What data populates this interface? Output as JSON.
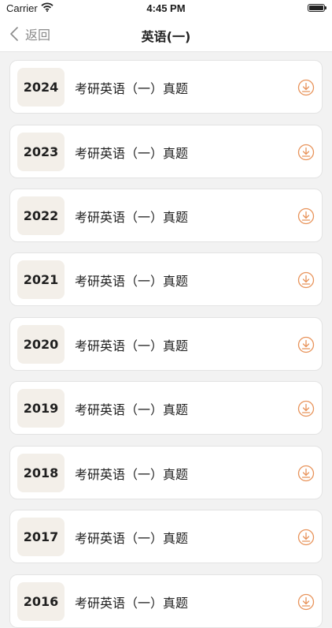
{
  "status_bar": {
    "carrier": "Carrier",
    "time": "4:45 PM"
  },
  "nav": {
    "back_label": "返回",
    "title": "英语(一)"
  },
  "colors": {
    "accent": "#e8935a",
    "year_badge_bg": "#f3efe9"
  },
  "items": [
    {
      "year": "2024",
      "title": "考研英语（一）真题"
    },
    {
      "year": "2023",
      "title": "考研英语（一）真题"
    },
    {
      "year": "2022",
      "title": "考研英语（一）真题"
    },
    {
      "year": "2021",
      "title": "考研英语（一）真题"
    },
    {
      "year": "2020",
      "title": "考研英语（一）真题"
    },
    {
      "year": "2019",
      "title": "考研英语（一）真题"
    },
    {
      "year": "2018",
      "title": "考研英语（一）真题"
    },
    {
      "year": "2017",
      "title": "考研英语（一）真题"
    },
    {
      "year": "2016",
      "title": "考研英语（一）真题"
    }
  ]
}
